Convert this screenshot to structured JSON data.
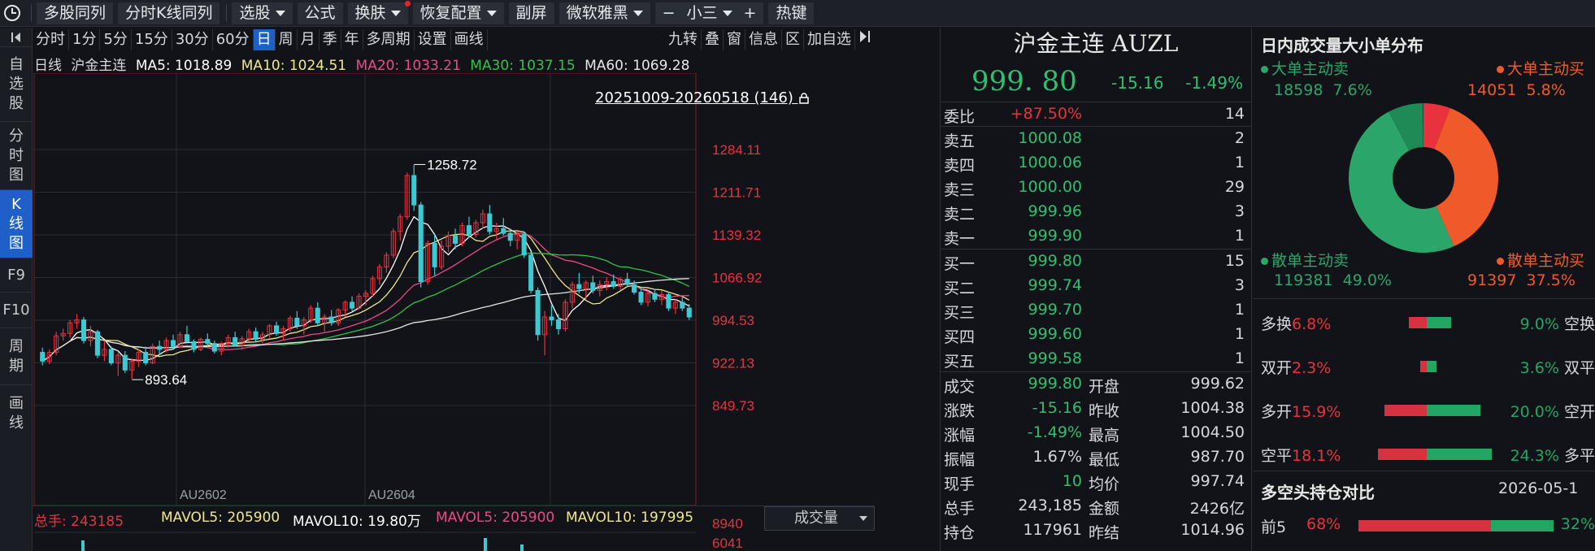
{
  "toolbar": {
    "buttons": [
      "多股同列",
      "分时K线同列",
      "选股",
      "公式",
      "换肤",
      "恢复配置",
      "副屏",
      "微软雅黑",
      "小三",
      "热键"
    ],
    "minus": "−",
    "plus": "+"
  },
  "leftnav": [
    "自选股",
    "分时图",
    "K线图",
    "F9",
    "F10",
    "周期",
    "画线"
  ],
  "periods": [
    "分时",
    "1分",
    "5分",
    "15分",
    "30分",
    "60分",
    "日",
    "周",
    "月",
    "季",
    "年",
    "多周期",
    "设置",
    "画线"
  ],
  "period_right": [
    "九转",
    "叠",
    "窗",
    "信息",
    "区",
    "加自选"
  ],
  "ma_legend": {
    "period": "日线",
    "name": "沪金主连",
    "ma5": "MA5: 1018.89",
    "ma10": "MA10: 1024.51",
    "ma20": "MA20: 1033.21",
    "ma30": "MA30: 1037.15",
    "ma60": "MA60: 1069.28"
  },
  "range_label": "20251009-20260518 (146)",
  "colors": {
    "up": "#e8333e",
    "down": "#3ec8d2",
    "ma5": "#ffffff",
    "ma10": "#f0e88a",
    "ma20": "#e84a8a",
    "ma30": "#33c24a",
    "ma60": "#e6e6e6",
    "accent": "#1e5fc8"
  },
  "chart_data": {
    "type": "candlestick",
    "y_ticks": [
      "1284.11",
      "1211.71",
      "1139.32",
      "1066.92",
      "994.53",
      "922.13",
      "849.73"
    ],
    "ylim": [
      800,
      1300
    ],
    "x_labels": [
      "AU2602",
      "AU2604"
    ],
    "annotations": {
      "high": "1258.72",
      "low": "893.64"
    },
    "candles": [
      [
        940,
        948,
        918,
        925
      ],
      [
        925,
        945,
        920,
        940
      ],
      [
        940,
        975,
        935,
        968
      ],
      [
        968,
        980,
        960,
        972
      ],
      [
        972,
        995,
        965,
        990
      ],
      [
        990,
        1005,
        980,
        995
      ],
      [
        995,
        1000,
        955,
        960
      ],
      [
        960,
        985,
        950,
        975
      ],
      [
        975,
        978,
        930,
        935
      ],
      [
        935,
        960,
        925,
        945
      ],
      [
        945,
        950,
        918,
        922
      ],
      [
        922,
        940,
        900,
        935
      ],
      [
        935,
        942,
        905,
        910
      ],
      [
        910,
        930,
        895,
        925
      ],
      [
        925,
        945,
        915,
        940
      ],
      [
        940,
        950,
        918,
        922
      ],
      [
        922,
        955,
        920,
        950
      ],
      [
        950,
        960,
        935,
        945
      ],
      [
        945,
        965,
        940,
        960
      ],
      [
        960,
        970,
        945,
        950
      ],
      [
        950,
        975,
        948,
        970
      ],
      [
        970,
        985,
        955,
        958
      ],
      [
        958,
        962,
        940,
        945
      ],
      [
        945,
        965,
        942,
        962
      ],
      [
        962,
        972,
        950,
        955
      ],
      [
        955,
        960,
        938,
        942
      ],
      [
        942,
        958,
        935,
        955
      ],
      [
        955,
        970,
        948,
        965
      ],
      [
        965,
        975,
        950,
        952
      ],
      [
        952,
        968,
        945,
        963
      ],
      [
        963,
        980,
        958,
        975
      ],
      [
        975,
        982,
        958,
        962
      ],
      [
        962,
        975,
        955,
        970
      ],
      [
        970,
        988,
        965,
        985
      ],
      [
        985,
        992,
        968,
        972
      ],
      [
        972,
        985,
        960,
        980
      ],
      [
        980,
        1002,
        975,
        998
      ],
      [
        998,
        1010,
        980,
        985
      ],
      [
        985,
        1000,
        970,
        995
      ],
      [
        995,
        1020,
        990,
        1015
      ],
      [
        1015,
        1025,
        985,
        990
      ],
      [
        990,
        1005,
        975,
        1000
      ],
      [
        1000,
        1012,
        985,
        990
      ],
      [
        990,
        1015,
        985,
        1012
      ],
      [
        1012,
        1028,
        1000,
        1025
      ],
      [
        1025,
        1035,
        1010,
        1015
      ],
      [
        1015,
        1040,
        1012,
        1035
      ],
      [
        1035,
        1045,
        1020,
        1040
      ],
      [
        1040,
        1070,
        1035,
        1065
      ],
      [
        1065,
        1090,
        1055,
        1085
      ],
      [
        1085,
        1110,
        1075,
        1105
      ],
      [
        1105,
        1150,
        1100,
        1145
      ],
      [
        1145,
        1175,
        1130,
        1170
      ],
      [
        1170,
        1245,
        1165,
        1240
      ],
      [
        1240,
        1258,
        1180,
        1190
      ],
      [
        1190,
        1195,
        1050,
        1060
      ],
      [
        1060,
        1130,
        1055,
        1125
      ],
      [
        1125,
        1140,
        1070,
        1085
      ],
      [
        1085,
        1130,
        1080,
        1120
      ],
      [
        1120,
        1145,
        1110,
        1138
      ],
      [
        1138,
        1150,
        1115,
        1125
      ],
      [
        1125,
        1160,
        1120,
        1155
      ],
      [
        1155,
        1170,
        1135,
        1140
      ],
      [
        1140,
        1165,
        1135,
        1160
      ],
      [
        1160,
        1182,
        1150,
        1175
      ],
      [
        1175,
        1190,
        1140,
        1145
      ],
      [
        1145,
        1160,
        1130,
        1150
      ],
      [
        1150,
        1168,
        1138,
        1142
      ],
      [
        1142,
        1150,
        1120,
        1130
      ],
      [
        1130,
        1145,
        1115,
        1140
      ],
      [
        1140,
        1145,
        1100,
        1105
      ],
      [
        1105,
        1110,
        1040,
        1045
      ],
      [
        1045,
        1050,
        960,
        970
      ],
      [
        970,
        1010,
        935,
        1000
      ],
      [
        1000,
        1020,
        985,
        995
      ],
      [
        995,
        1005,
        970,
        980
      ],
      [
        980,
        1030,
        975,
        1025
      ],
      [
        1025,
        1060,
        1015,
        1055
      ],
      [
        1055,
        1075,
        1040,
        1048
      ],
      [
        1048,
        1062,
        1030,
        1058
      ],
      [
        1058,
        1070,
        1040,
        1045
      ],
      [
        1045,
        1062,
        1035,
        1055
      ],
      [
        1055,
        1068,
        1045,
        1060
      ],
      [
        1060,
        1072,
        1048,
        1052
      ],
      [
        1052,
        1068,
        1045,
        1064
      ],
      [
        1064,
        1075,
        1050,
        1055
      ],
      [
        1055,
        1062,
        1038,
        1042
      ],
      [
        1042,
        1050,
        1020,
        1025
      ],
      [
        1025,
        1045,
        1018,
        1040
      ],
      [
        1040,
        1048,
        1025,
        1030
      ],
      [
        1030,
        1045,
        1020,
        1038
      ],
      [
        1038,
        1042,
        1010,
        1015
      ],
      [
        1015,
        1030,
        1005,
        1025
      ],
      [
        1025,
        1035,
        1010,
        1015
      ],
      [
        1015,
        1022,
        995,
        1000
      ]
    ]
  },
  "volume": {
    "total": "总手: 243185",
    "mavol5_a": "MAVOL5: 205900",
    "mavol10_a": "MAVOL10: 19.80万",
    "mavol5_b": "MAVOL5: 205900",
    "mavol10_b": "MAVOL10: 197995",
    "selector": "成交量",
    "axis_top": "8940",
    "axis_bottom": "6041"
  },
  "quote": {
    "name": "沪金主连 AUZL",
    "last": "999. 80",
    "change": "-15.16",
    "change_pct": "-1.49%",
    "weibi": {
      "label": "委比",
      "value": "+87.50%",
      "num": "14"
    },
    "asks": [
      {
        "label": "卖五",
        "price": "1000.08",
        "vol": "2"
      },
      {
        "label": "卖四",
        "price": "1000.06",
        "vol": "1"
      },
      {
        "label": "卖三",
        "price": "1000.00",
        "vol": "29"
      },
      {
        "label": "卖二",
        "price": "999.96",
        "vol": "3"
      },
      {
        "label": "卖一",
        "price": "999.90",
        "vol": "1"
      }
    ],
    "bids": [
      {
        "label": "买一",
        "price": "999.80",
        "vol": "15"
      },
      {
        "label": "买二",
        "price": "999.74",
        "vol": "3"
      },
      {
        "label": "买三",
        "price": "999.70",
        "vol": "1"
      },
      {
        "label": "买四",
        "price": "999.60",
        "vol": "1"
      },
      {
        "label": "买五",
        "price": "999.58",
        "vol": "1"
      }
    ],
    "stats": [
      {
        "l1": "成交",
        "v1": "999.80",
        "c1": "green",
        "l2": "开盘",
        "v2": "999.62",
        "c2": "green"
      },
      {
        "l1": "涨跌",
        "v1": "-15.16",
        "c1": "green",
        "l2": "昨收",
        "v2": "1004.38",
        "c2": "green"
      },
      {
        "l1": "涨幅",
        "v1": "-1.49%",
        "c1": "green",
        "l2": "最高",
        "v2": "1004.50",
        "c2": "green"
      },
      {
        "l1": "振幅",
        "v1": "1.67%",
        "c1": "white",
        "l2": "最低",
        "v2": "987.70",
        "c2": "green"
      },
      {
        "l1": "现手",
        "v1": "10",
        "c1": "green",
        "l2": "均价",
        "v2": "997.74",
        "c2": "green"
      },
      {
        "l1": "总手",
        "v1": "243,185",
        "c1": "white",
        "l2": "金额",
        "v2": "2426亿",
        "c2": "white"
      },
      {
        "l1": "持仓",
        "v1": "117961",
        "c1": "white",
        "l2": "昨结",
        "v2": "1014.96",
        "c2": "white"
      }
    ]
  },
  "flow": {
    "title": "日内成交量大小单分布",
    "big_sell": {
      "label": "大单主动卖",
      "value": "18598",
      "pct": "7.6%"
    },
    "big_buy": {
      "label": "大单主动买",
      "value": "14051",
      "pct": "5.8%"
    },
    "small_sell": {
      "label": "散单主动卖",
      "value": "119381",
      "pct": "49.0%"
    },
    "small_buy": {
      "label": "散单主动买",
      "value": "91397",
      "pct": "37.5%"
    },
    "donut": [
      {
        "name": "big_buy",
        "frac": 0.058,
        "color": "#e8333e"
      },
      {
        "name": "small_buy",
        "frac": 0.375,
        "color": "#f05a2a"
      },
      {
        "name": "small_sell",
        "frac": 0.49,
        "color": "#2ba56a"
      },
      {
        "name": "big_sell",
        "frac": 0.076,
        "color": "#1f8a55"
      }
    ],
    "bars": [
      {
        "l": "多换",
        "lp": "6.8%",
        "rp": "9.0%",
        "rl": "空换",
        "red": 0.068,
        "green": 0.09
      },
      {
        "l": "双开",
        "lp": "2.3%",
        "rp": "3.6%",
        "rl": "双平",
        "red": 0.023,
        "green": 0.036
      },
      {
        "l": "多开",
        "lp": "15.9%",
        "rp": "20.0%",
        "rl": "空开",
        "red": 0.159,
        "green": 0.2
      },
      {
        "l": "空平",
        "lp": "18.1%",
        "rp": "24.3%",
        "rl": "多平",
        "red": 0.181,
        "green": 0.243
      }
    ],
    "position_title": "多空头持仓对比",
    "position_date": "2026-05-1",
    "top5": {
      "label": "前5",
      "long": "68%",
      "short": "32%",
      "long_frac": 0.68
    }
  }
}
